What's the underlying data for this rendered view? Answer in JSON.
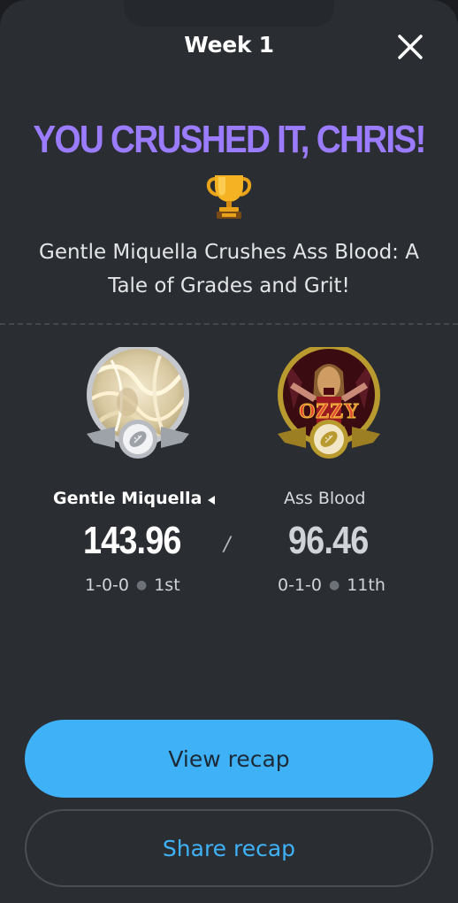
{
  "header": {
    "title": "Week 1",
    "close_icon": "close-icon"
  },
  "result": {
    "headline": "YOU CRUSHED IT, CHRIS!",
    "trophy_icon": "trophy-icon",
    "summary": "Gentle Miquella Crushes Ass Blood: A Tale of Grades and Grit!"
  },
  "matchup": {
    "separator": "/",
    "team_a": {
      "name": "Gentle Miquella",
      "score": "143.96",
      "record": "1-0-0",
      "rank": "1st",
      "is_user_team": true
    },
    "team_b": {
      "name": "Ass Blood",
      "score": "96.46",
      "record": "0-1-0",
      "rank": "11th",
      "avatar_text": "OZZY"
    }
  },
  "actions": {
    "view_recap": "View recap",
    "share_recap": "Share recap"
  },
  "colors": {
    "background": "#2a2d32",
    "headline": "#9b7cff",
    "primary_button": "#3fb2f7",
    "badge_gold": "#b99a2e",
    "badge_silver": "#b8bcc2"
  }
}
